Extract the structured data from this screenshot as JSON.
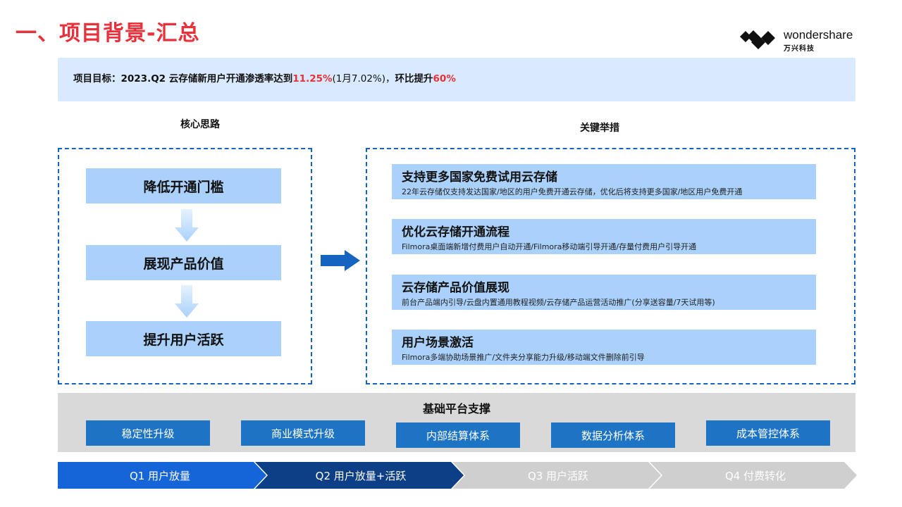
{
  "slide": {
    "title": "一、项目背景-汇总"
  },
  "logo": {
    "brand": "wondershare",
    "brand_cn": "万兴科技"
  },
  "goal": {
    "label": "项目目标：",
    "text1": "2023.Q2 云存储新用户开通渗透率达到",
    "rate": "11.25%",
    "text2": "(1月7.02%)，",
    "text3": "环比提升",
    "growth": "60%"
  },
  "core": {
    "heading": "核心思路",
    "steps": [
      "降低开通门槛",
      "展现产品价值",
      "提升用户活跃"
    ]
  },
  "key": {
    "heading": "关键举措",
    "measures": [
      {
        "title": "支持更多国家免费试用云存储",
        "desc": "22年云存储仅支持发达国家/地区的用户免费开通云存储，优化后将支持更多国家/地区用户免费开通"
      },
      {
        "title": "优化云存储开通流程",
        "desc": "Filmora桌面端新增付费用户自动开通/Filmora移动端引导开通/存量付费用户引导开通"
      },
      {
        "title": "云存储产品价值展现",
        "desc": "前台产品端内引导/云盘内置通用教程视频/云存储产品运营活动推广(分享送容量/7天试用等)"
      },
      {
        "title": "用户场景激活",
        "desc": "Filmora多端协助场景推广/文件夹分享能力升级/移动端文件删除前引导"
      }
    ]
  },
  "platform": {
    "title": "基础平台支撑",
    "items": [
      "稳定性升级",
      "商业模式升级",
      "内部结算体系",
      "数据分析体系",
      "成本管控体系"
    ]
  },
  "roadmap": {
    "phases": [
      {
        "label": "Q1 用户放量",
        "color": "#1565d8",
        "text_color": "#ffffff"
      },
      {
        "label": "Q2 用户放量+活跃",
        "color": "#0d3f86",
        "text_color": "#ffffff"
      },
      {
        "label": "Q3 用户活跃",
        "color": "#cfcfcf",
        "text_color": "#ffffff"
      },
      {
        "label": "Q4 付费转化",
        "color": "#cfcfcf",
        "text_color": "#ffffff"
      }
    ]
  }
}
